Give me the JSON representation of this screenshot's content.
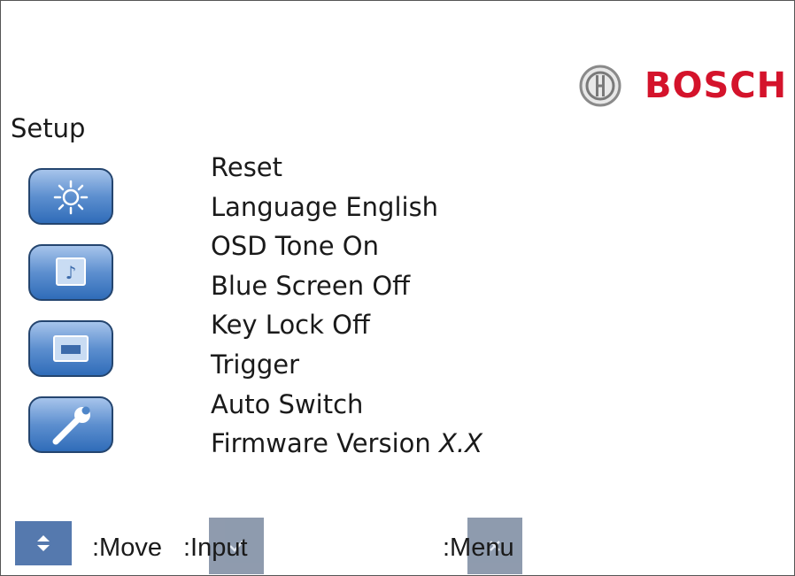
{
  "brand": {
    "name": "BOSCH",
    "color": "#d4132b"
  },
  "screen": {
    "title": "Setup"
  },
  "side_icons": [
    {
      "icon": "brightness-icon"
    },
    {
      "icon": "music-note-icon"
    },
    {
      "icon": "display-icon"
    },
    {
      "icon": "wrench-icon"
    }
  ],
  "menu": {
    "items": [
      {
        "label": "Reset"
      },
      {
        "label": "Language",
        "value": "English"
      },
      {
        "label": "OSD Tone",
        "value": "On"
      },
      {
        "label": "Blue Screen",
        "value": "Off"
      },
      {
        "label": "Key Lock",
        "value": "Off"
      },
      {
        "label": "Trigger"
      },
      {
        "label": "Auto Switch"
      },
      {
        "label": "Firmware Version",
        "value": "X.X"
      }
    ]
  },
  "footer": {
    "move_label": ":Move",
    "input_label": ":Input",
    "menu_label": ":Menu",
    "move_icon": "up-down-arrows-icon",
    "input_icon": "checkmark-icon",
    "menu_icon": "close-icon"
  }
}
